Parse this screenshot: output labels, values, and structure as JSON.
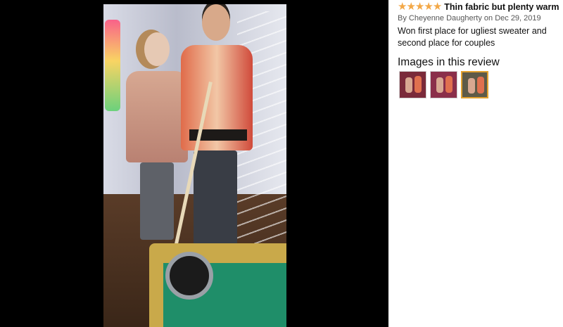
{
  "review": {
    "rating": 5,
    "stars": [
      "★",
      "★",
      "★",
      "★",
      "★"
    ],
    "title": "Thin fabric but plenty warm",
    "byline": "By Cheyenne Daugherty on Dec 29, 2019",
    "body": "Won first place for ugliest sweater and second place for couples"
  },
  "images_section": {
    "heading": "Images in this review",
    "thumbnails": [
      {
        "selected": false,
        "bg": "#7a2a3a"
      },
      {
        "selected": false,
        "bg": "#8a2f4a"
      },
      {
        "selected": true,
        "bg": "#5e5a48"
      }
    ]
  },
  "colors": {
    "star": "#f3a847",
    "selected_border": "#e3a12f",
    "viewer_bg": "#000000"
  }
}
